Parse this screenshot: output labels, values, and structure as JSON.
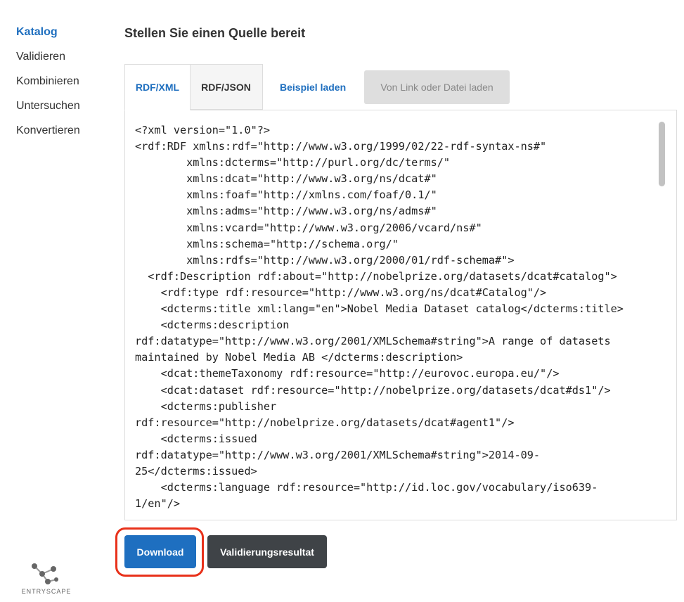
{
  "sidebar": {
    "items": [
      {
        "label": "Katalog",
        "active": true
      },
      {
        "label": "Validieren"
      },
      {
        "label": "Kombinieren"
      },
      {
        "label": "Untersuchen"
      },
      {
        "label": "Konvertieren"
      }
    ]
  },
  "logo": {
    "text": "ENTRYSCAPE"
  },
  "page": {
    "title": "Stellen Sie einen Quelle bereit"
  },
  "tabs": {
    "rdf_xml": "RDF/XML",
    "rdf_json": "RDF/JSON",
    "example_link": "Beispiel laden",
    "load_button": "Von Link oder Datei laden"
  },
  "editor": {
    "lines": [
      "<?xml version=\"1.0\"?>",
      "<rdf:RDF xmlns:rdf=\"http://www.w3.org/1999/02/22-rdf-syntax-ns#\"",
      "        xmlns:dcterms=\"http://purl.org/dc/terms/\"",
      "        xmlns:dcat=\"http://www.w3.org/ns/dcat#\"",
      "        xmlns:foaf=\"http://xmlns.com/foaf/0.1/\"",
      "        xmlns:adms=\"http://www.w3.org/ns/adms#\"",
      "        xmlns:vcard=\"http://www.w3.org/2006/vcard/ns#\"",
      "        xmlns:schema=\"http://schema.org/\"",
      "        xmlns:rdfs=\"http://www.w3.org/2000/01/rdf-schema#\">",
      "  <rdf:Description rdf:about=\"http://nobelprize.org/datasets/dcat#catalog\">",
      "    <rdf:type rdf:resource=\"http://www.w3.org/ns/dcat#Catalog\"/>",
      "    <dcterms:title xml:lang=\"en\">Nobel Media Dataset catalog</dcterms:title>",
      "    <dcterms:description",
      "rdf:datatype=\"http://www.w3.org/2001/XMLSchema#string\">A range of datasets",
      "maintained by Nobel Media AB </dcterms:description>",
      "    <dcat:themeTaxonomy rdf:resource=\"http://eurovoc.europa.eu/\"/>",
      "    <dcat:dataset rdf:resource=\"http://nobelprize.org/datasets/dcat#ds1\"/>",
      "    <dcterms:publisher",
      "rdf:resource=\"http://nobelprize.org/datasets/dcat#agent1\"/>",
      "    <dcterms:issued",
      "rdf:datatype=\"http://www.w3.org/2001/XMLSchema#string\">2014-09-",
      "25</dcterms:issued>",
      "    <dcterms:language rdf:resource=\"http://id.loc.gov/vocabulary/iso639-",
      "1/en\"/>"
    ]
  },
  "actions": {
    "download": "Download",
    "validation_result": "Validierungsresultat"
  },
  "colors": {
    "accent": "#1e6fc0",
    "dark_button": "#3f4347",
    "highlight": "#e8311a"
  }
}
